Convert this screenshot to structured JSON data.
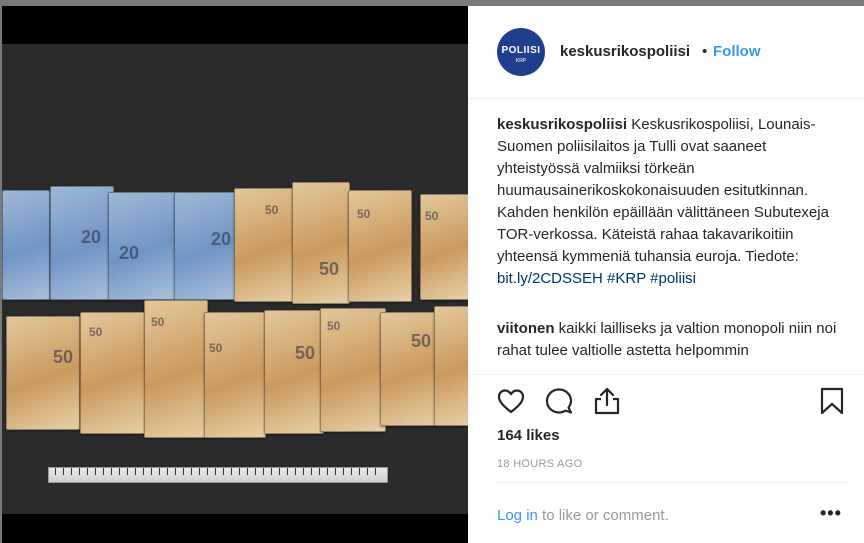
{
  "post": {
    "username": "keskusrikospoliisi",
    "follow_label": "Follow",
    "separator": "•",
    "avatar": {
      "line1": "POLIISI",
      "line2": "KRP"
    }
  },
  "caption": {
    "username": "keskusrikospoliisi",
    "text": " Keskusrikospoliisi, Lounais-Suomen poliisilaitos ja Tulli ovat saaneet yhteistyössä valmiiksi törkeän huumausainerikoskokonaisuuden esitutkinnan. Kahden henkilön epäillään välittäneen Subutexeja TOR-verkossa. Käteistä rahaa takavarikoitiin yhteensä kymmeniä tuhansia euroja. Tiedote: ",
    "url": "bit.ly/2CDSSEH",
    "hashtags": [
      "#KRP",
      "#poliisi"
    ]
  },
  "comment": {
    "username": "viitonen",
    "text": " kaikki lailliseks ja valtion monopoli niin noi rahat tulee valtiolle astetta helpommin"
  },
  "actions": {
    "icons": [
      "heart-icon",
      "comment-icon",
      "share-icon",
      "bookmark-icon"
    ]
  },
  "likes": "164 likes",
  "timestamp": "18 HOURS AGO",
  "footer": {
    "login_link": "Log in",
    "login_text": " to like or comment.",
    "more": "•••"
  },
  "colors": {
    "link_blue": "#3897f0",
    "text": "#262626",
    "muted": "#999999",
    "police_blue": "#1f3f8c"
  }
}
